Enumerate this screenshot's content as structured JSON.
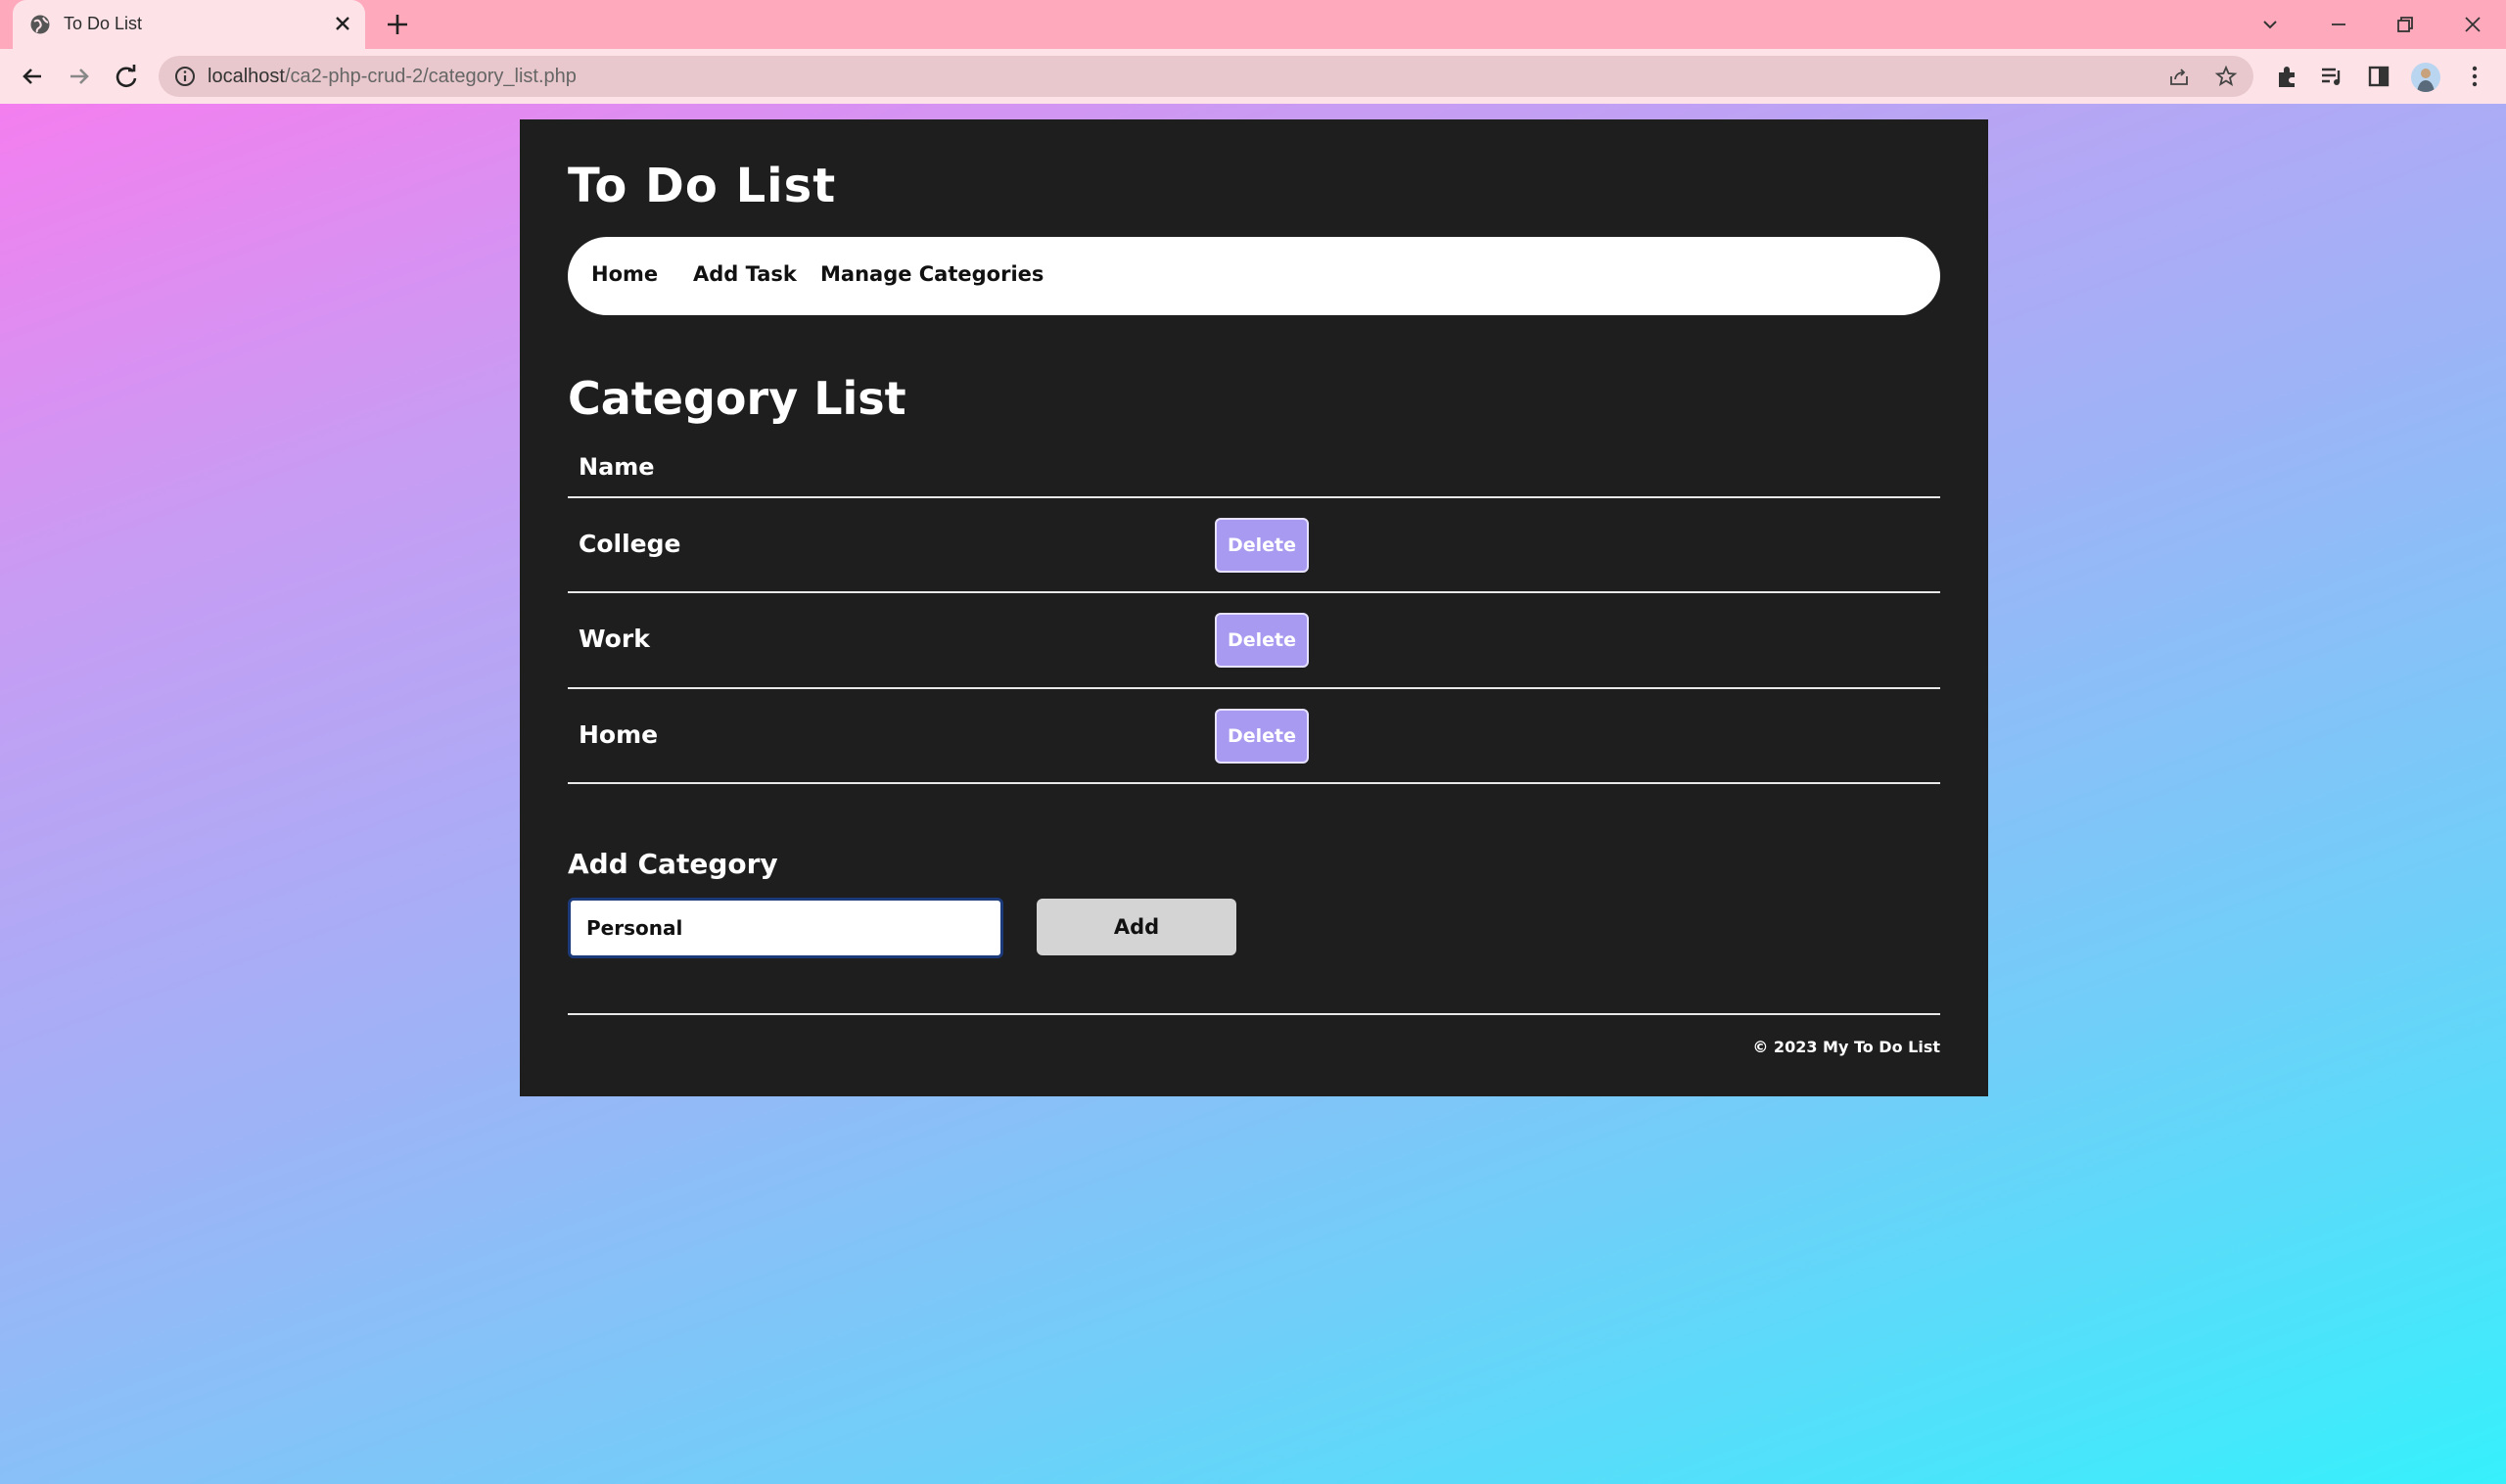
{
  "browser": {
    "tab_title": "To Do List",
    "url_host": "localhost",
    "url_path": "/ca2-php-crud-2/category_list.php"
  },
  "site": {
    "title": "To Do List",
    "nav": [
      "Home",
      "Add Task",
      "Manage Categories"
    ]
  },
  "category_list": {
    "heading": "Category List",
    "column_header": "Name",
    "rows": [
      {
        "name": "College",
        "action": "Delete"
      },
      {
        "name": "Work",
        "action": "Delete"
      },
      {
        "name": "Home",
        "action": "Delete"
      }
    ]
  },
  "add_category": {
    "heading": "Add Category",
    "input_value": "Personal",
    "button_label": "Add"
  },
  "footer": {
    "text": "© 2023 My To Do List"
  },
  "colors": {
    "delete_button": "#a79af0",
    "card_background": "#1e1e1e",
    "titlebar": "#ffaabc"
  }
}
